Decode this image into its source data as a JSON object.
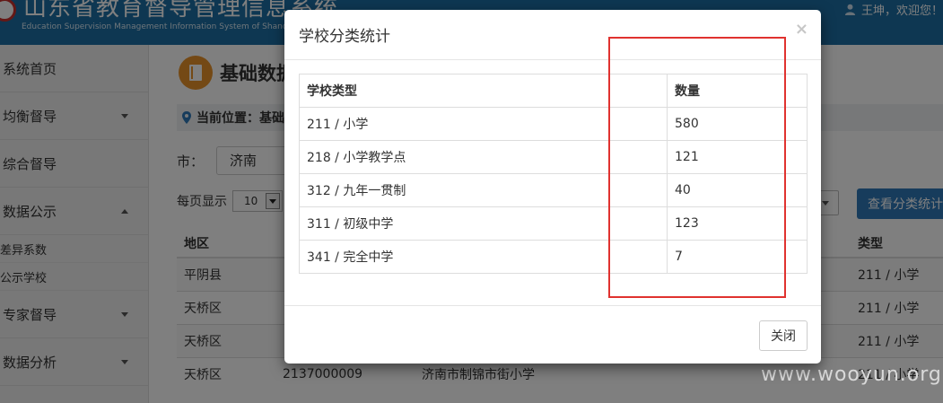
{
  "app": {
    "title": "山东省教育督导管理信息系统",
    "subtitle": "Education Supervision Management Information System of Shandong Pro",
    "user_greeting": "王坤，欢迎您！"
  },
  "sidebar": {
    "items": [
      {
        "label": "系统首页"
      },
      {
        "label": "均衡督导"
      },
      {
        "label": "综合督导"
      },
      {
        "label": "数据公示"
      },
      {
        "label": "差异系数"
      },
      {
        "label": "公示学校"
      },
      {
        "label": "专家督导"
      },
      {
        "label": "数据分析"
      }
    ]
  },
  "main": {
    "page_title": "基础数据",
    "breadcrumb": "当前位置：基础",
    "city_label": "市：",
    "city_value": "济南",
    "page_size_label": "每页显示",
    "page_size_value": "10",
    "stats_button": "查看分类统计",
    "table_headers": [
      "地区",
      "类型"
    ],
    "rows": [
      {
        "region": "平阴县",
        "type": "211 / 小学"
      },
      {
        "region": "天桥区",
        "type": "211 / 小学"
      },
      {
        "region": "天桥区",
        "type": "211 / 小学"
      },
      {
        "region": "天桥区",
        "code": "2137000009",
        "name": "济南市制锦市街小学",
        "type": "211 / 小学"
      }
    ]
  },
  "modal": {
    "title": "学校分类统计",
    "close_x": "×",
    "columns": [
      "学校类型",
      "数量"
    ],
    "rows": [
      {
        "type": "211 / 小学",
        "count": "580"
      },
      {
        "type": "218 / 小学教学点",
        "count": "121"
      },
      {
        "type": "312 / 九年一贯制",
        "count": "40"
      },
      {
        "type": "311 / 初级中学",
        "count": "123"
      },
      {
        "type": "341 / 完全中学",
        "count": "7"
      }
    ],
    "close_button": "关闭"
  },
  "watermark": "www.wooyun.org",
  "colors": {
    "header_bg": "#1d6fa5",
    "primary_button": "#2f79b9",
    "page_icon": "#e8932b",
    "highlight": "#e0322f"
  }
}
